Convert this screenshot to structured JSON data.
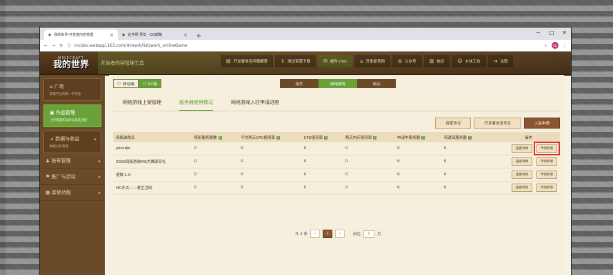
{
  "browser": {
    "tabs": [
      {
        "title": "我的世界-开发者内容管理",
        "active": true
      },
      {
        "title": "证件照-预览 - QQ邮箱",
        "active": false
      }
    ],
    "url": "mcdev.webapp.163.com/#/work/list/work_onlineGame",
    "profile_initials": "ED",
    "win_min": "−",
    "win_max": "□",
    "win_close": "✕"
  },
  "brand": {
    "logo_top": "MINECRAFT",
    "logo_main": "我的世界",
    "portal_title": "开发者内容管理工具"
  },
  "topnav": [
    {
      "label": "开发者常见问题解答",
      "icon": "chat-icon"
    },
    {
      "label": "测试资源下载",
      "icon": "download-icon"
    },
    {
      "label": "邮件 (30)",
      "icon": "mail-icon"
    },
    {
      "label": "开发者官网",
      "icon": "site-icon"
    },
    {
      "label": "公众号",
      "icon": "wechat-icon"
    },
    {
      "label": "协议",
      "icon": "doc-icon"
    },
    {
      "label": "方块工坊",
      "icon": "user-icon"
    },
    {
      "label": "注销",
      "icon": "logout-icon"
    }
  ],
  "sidebar": [
    {
      "label": "广场",
      "sub": "获取平台的每一手资源",
      "active": false,
      "card": true
    },
    {
      "label": "作品管理",
      "sub": "上架管理作品的信息及流程",
      "active": true,
      "card": true
    },
    {
      "label": "数据与收益",
      "sub": "数据分析管理",
      "active": false,
      "card": true
    },
    {
      "label": "账号管理",
      "sub": "",
      "active": false,
      "card": false
    },
    {
      "label": "推广与活动",
      "sub": "",
      "active": false,
      "card": false
    },
    {
      "label": "其他功能",
      "sub": "",
      "active": false,
      "card": false
    }
  ],
  "platform_toggle": {
    "mobile": "移动端",
    "pc": "PC端"
  },
  "category_tabs": [
    {
      "label": "组件",
      "active": false
    },
    {
      "label": "网络游戏",
      "active": true
    },
    {
      "label": "商品",
      "active": false
    }
  ],
  "subtabs": [
    {
      "label": "网络游戏上架管理",
      "active": false
    },
    {
      "label": "服务器使用情况",
      "active": true
    },
    {
      "label": "网络游戏入驻申请进度",
      "active": false
    }
  ],
  "actions": {
    "protocol": "保密协议",
    "zone": "开发者信息专区",
    "apply": "入驻申请"
  },
  "table": {
    "headers": [
      "网络游戏名",
      "使用服务器数",
      "平均两天CPU使用率",
      "CPU使用率",
      "两天内存使用率",
      "申请中服务器",
      "待退回服务器",
      "操作"
    ],
    "rows": [
      {
        "name": "jaisodja",
        "cells": [
          "0",
          "0",
          "0",
          "0",
          "0",
          "0"
        ]
      },
      {
        "name": "2020网易游戏MG大赛部实礼",
        "cells": [
          "0",
          "0",
          "0",
          "0",
          "0",
          "0"
        ]
      },
      {
        "name": "速描 1.0",
        "cells": [
          "0",
          "0",
          "0",
          "0",
          "0",
          "0"
        ]
      },
      {
        "name": "MC乐大——爱生活网",
        "cells": [
          "0",
          "0",
          "0",
          "0",
          "0",
          "0"
        ]
      }
    ],
    "op_view": "查看详情",
    "op_apply": "申请新增"
  },
  "pager": {
    "total": "共 4 条",
    "prev": "‹",
    "page": "1",
    "next": "›",
    "goto": "前往",
    "goto_value": "1",
    "unit": "页"
  },
  "colors": {
    "brown": "#6b4a27",
    "green": "#6aa23a",
    "highlight": "#e0302b"
  }
}
